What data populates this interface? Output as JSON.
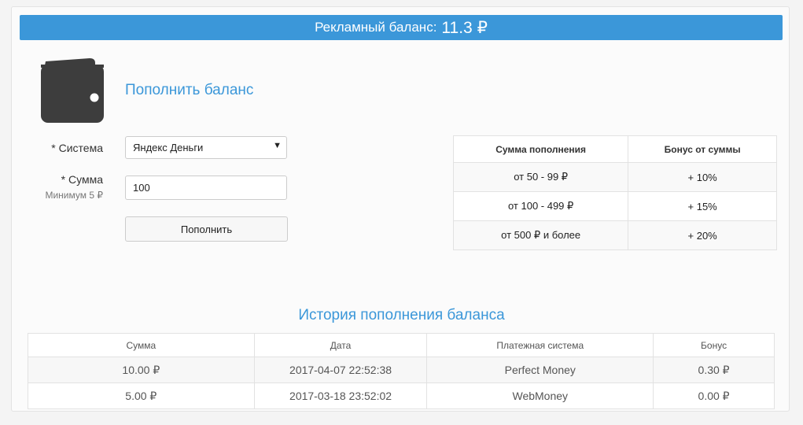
{
  "balance": {
    "label": "Рекламный баланс:",
    "amount": "11.3 ₽"
  },
  "topup": {
    "title": "Пополнить баланс",
    "icon": "wallet-icon",
    "system_label": "* Система",
    "system_value": "Яндекс Деньги",
    "amount_label": "* Сумма",
    "amount_hint": "Минимум 5 ₽",
    "amount_value": "100",
    "submit_label": "Пополнить"
  },
  "bonus_table": {
    "headers": [
      "Сумма пополнения",
      "Бонус от суммы"
    ],
    "rows": [
      [
        "от 50 - 99 ₽",
        "+ 10%"
      ],
      [
        "от 100 - 499 ₽",
        "+ 15%"
      ],
      [
        "от 500 ₽ и более",
        "+ 20%"
      ]
    ]
  },
  "history": {
    "title": "История пополнения баланса",
    "headers": [
      "Сумма",
      "Дата",
      "Платежная система",
      "Бонус"
    ],
    "rows": [
      [
        "10.00 ₽",
        "2017-04-07 22:52:38",
        "Perfect Money",
        "0.30 ₽"
      ],
      [
        "5.00 ₽",
        "2017-03-18 23:52:02",
        "WebMoney",
        "0.00 ₽"
      ]
    ]
  },
  "colors": {
    "accent": "#3b97d9",
    "icon": "#3d3d3d"
  }
}
